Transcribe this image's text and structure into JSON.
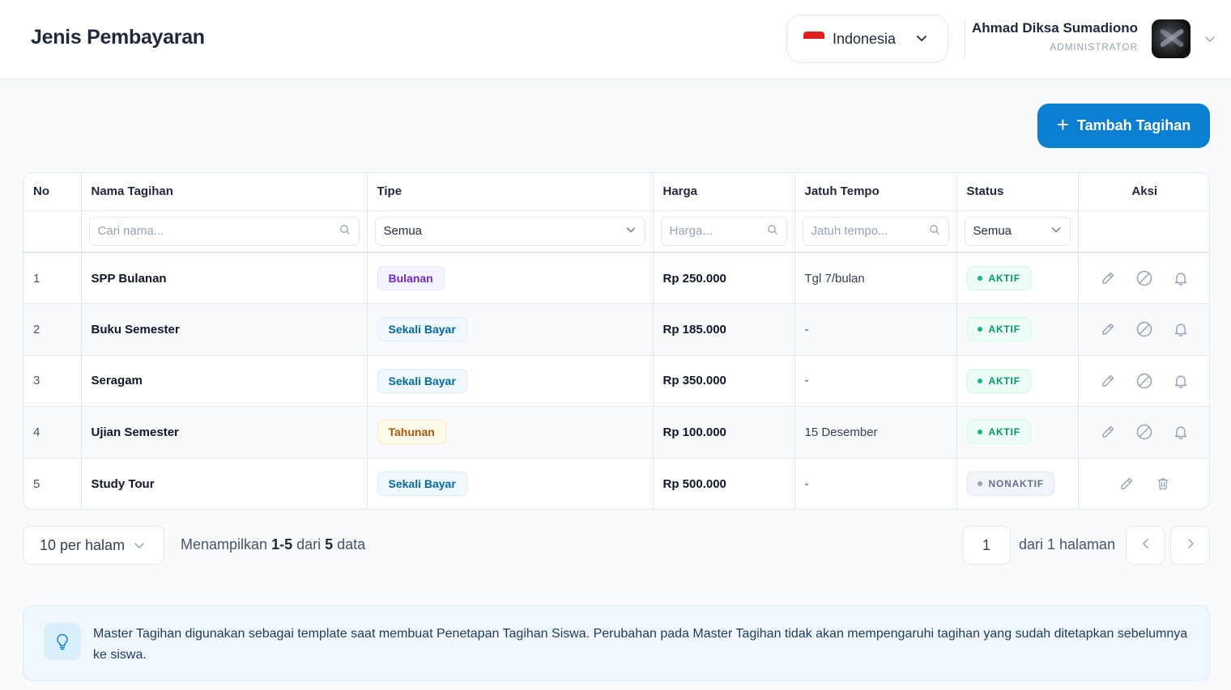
{
  "header": {
    "title": "Jenis Pembayaran",
    "language": "Indonesia",
    "user_name": "Ahmad Diksa Sumadiono",
    "user_role": "ADMINISTRATOR"
  },
  "add_button": {
    "label": "Tambah Tagihan",
    "icon": "plus-icon"
  },
  "table": {
    "columns": [
      "No",
      "Nama Tagihan",
      "Tipe",
      "Harga",
      "Jatuh Tempo",
      "Status",
      "Aksi"
    ],
    "filters": {
      "name_placeholder": "Cari nama...",
      "type_value": "Semua",
      "price_placeholder": "Harga...",
      "due_placeholder": "Jatuh tempo...",
      "status_value": "Semua"
    },
    "rows": [
      {
        "no": "1",
        "name": "SPP Bulanan",
        "type": "Bulanan",
        "price": "Rp 250.000",
        "due": "Tgl 7/bulan",
        "status": "AKTIF"
      },
      {
        "no": "2",
        "name": "Buku Semester",
        "type": "Sekali Bayar",
        "price": "Rp 185.000",
        "due": "-",
        "status": "AKTIF"
      },
      {
        "no": "3",
        "name": "Seragam",
        "type": "Sekali Bayar",
        "price": "Rp 350.000",
        "due": "-",
        "status": "AKTIF"
      },
      {
        "no": "4",
        "name": "Ujian Semester",
        "type": "Tahunan",
        "price": "Rp 100.000",
        "due": "15 Desember",
        "status": "AKTIF"
      },
      {
        "no": "5",
        "name": "Study Tour",
        "type": "Sekali Bayar",
        "price": "Rp 500.000",
        "due": "-",
        "status": "NONAKTIF"
      }
    ]
  },
  "pagination": {
    "per_page": "10 per halam",
    "showing_prefix": "Menampilkan ",
    "showing_range": "1-5",
    "showing_mid": " dari ",
    "showing_total": "5",
    "showing_suffix": " data",
    "current_page": "1",
    "page_of": "dari 1 halaman"
  },
  "info": {
    "icon": "lightbulb-icon",
    "text": "Master Tagihan digunakan sebagai template saat membuat Penetapan Tagihan Siswa. Perubahan pada Master Tagihan tidak akan mempengaruhi tagihan yang sudah ditetapkan sebelumnya ke siswa."
  },
  "colors": {
    "primary": "#0b7fd1",
    "active_green": "#059669",
    "inactive_gray": "#64748b",
    "monthly_purple": "#6d28d9",
    "once_blue": "#0369a1",
    "yearly_amber": "#b45309"
  }
}
